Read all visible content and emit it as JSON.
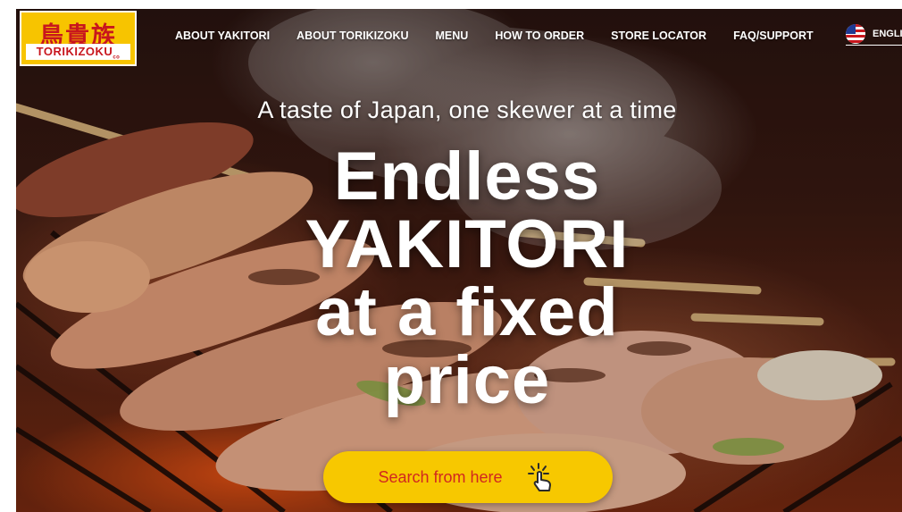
{
  "brand": {
    "logo_kanji": "鳥貴族",
    "logo_text": "TORIKIZOKU",
    "logo_suffix": "co",
    "accent_yellow": "#f7c400",
    "accent_red": "#c8161d"
  },
  "nav": {
    "items": [
      {
        "label": "ABOUT YAKITORI"
      },
      {
        "label": "ABOUT TORIKIZOKU"
      },
      {
        "label": "MENU"
      },
      {
        "label": "HOW TO ORDER"
      },
      {
        "label": "STORE LOCATOR"
      },
      {
        "label": "FAQ/SUPPORT"
      }
    ],
    "language": {
      "label": "ENGLIS",
      "icon": "us-flag-icon"
    }
  },
  "hero": {
    "tagline": "A taste of Japan, one skewer at a time",
    "headline_lines": [
      "Endless",
      "YAKITORI",
      "at a fixed",
      "price"
    ],
    "cta_label": "Search from here",
    "cta_icon": "tap-hand-icon"
  }
}
